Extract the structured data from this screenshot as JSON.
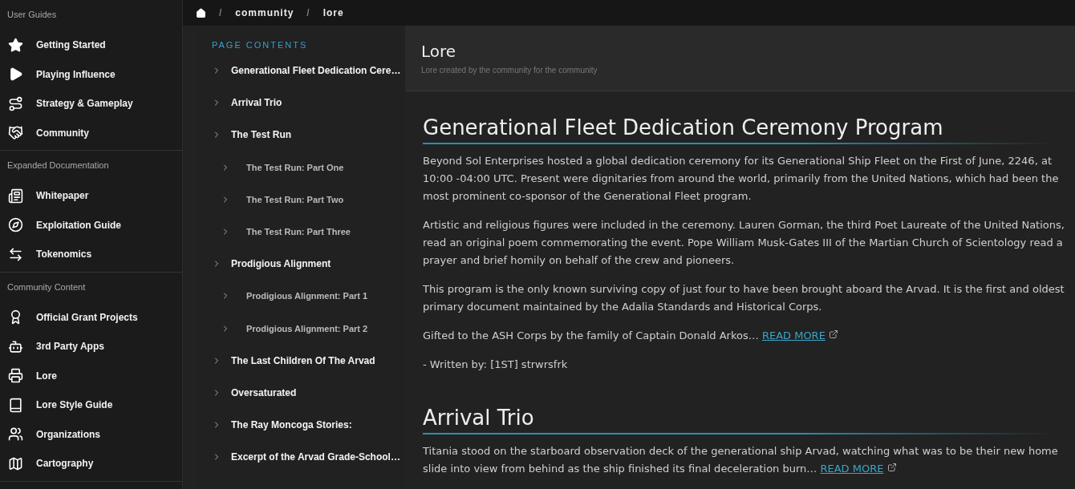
{
  "sidebar": {
    "sections": [
      {
        "title": "User Guides",
        "items": [
          {
            "label": "Getting Started"
          },
          {
            "label": "Playing Influence"
          },
          {
            "label": "Strategy & Gameplay"
          },
          {
            "label": "Community"
          }
        ]
      },
      {
        "title": "Expanded Documentation",
        "items": [
          {
            "label": "Whitepaper"
          },
          {
            "label": "Exploitation Guide"
          },
          {
            "label": "Tokenomics"
          }
        ]
      },
      {
        "title": "Community Content",
        "items": [
          {
            "label": "Official Grant Projects"
          },
          {
            "label": "3rd Party Apps"
          },
          {
            "label": "Lore"
          },
          {
            "label": "Lore Style Guide"
          },
          {
            "label": "Organizations"
          },
          {
            "label": "Cartography"
          }
        ]
      }
    ]
  },
  "breadcrumbs": [
    {
      "separator": "/",
      "label": "community"
    },
    {
      "separator": "/",
      "label": "lore"
    }
  ],
  "page_contents": {
    "title": "PAGE CONTENTS",
    "items": [
      {
        "label": "Generational Fleet Dedication Cere…"
      },
      {
        "label": "Arrival Trio"
      },
      {
        "label": "The Test Run",
        "children": [
          {
            "label": "The Test Run: Part One"
          },
          {
            "label": "The Test Run: Part Two"
          },
          {
            "label": "The Test Run: Part Three"
          }
        ]
      },
      {
        "label": "Prodigious Alignment",
        "children": [
          {
            "label": "Prodigious Alignment: Part 1"
          },
          {
            "label": "Prodigious Alignment: Part 2"
          }
        ]
      },
      {
        "label": "The Last Children Of The Arvad"
      },
      {
        "label": "Oversaturated"
      },
      {
        "label": "The Ray Moncoga Stories:"
      },
      {
        "label": "Excerpt of the Arvad Grade-School…"
      }
    ]
  },
  "header": {
    "title": "Lore",
    "subtitle": "Lore created by the community for the community"
  },
  "articles": [
    {
      "title": "Generational Fleet Dedication Ceremony Program",
      "paragraphs": [
        {
          "text": "Beyond Sol Enterprises hosted a global dedication ceremony for its Generational Ship Fleet on the First of June, 2246, at 10:00 -04:00 UTC. Present were dignitaries from around the world, primarily from the United Nations, which had been the most prominent co-sponsor of the Generational Fleet program."
        },
        {
          "text": "Artistic and religious figures were included in the ceremony. Lauren Gorman, the third Poet Laureate of the United Nations, read an original poem commemorating the event. Pope William Musk-Gates III of the Martian Church of Scientology read a prayer and brief homily on behalf of the crew and pioneers."
        },
        {
          "text": "This program is the only known surviving copy of just four to have been brought aboard the Arvad. It is the first and oldest primary document maintained by the Adalia Standards and Historical Corps."
        },
        {
          "text": "Gifted to the ASH Corps by the family of Captain Donald Arkos…",
          "link": "READ MORE"
        },
        {
          "text": "- Written by: [1ST] strwrsfrk"
        }
      ]
    },
    {
      "title": "Arrival Trio",
      "paragraphs": [
        {
          "text": "Titania stood on the starboard observation deck of the generational ship Arvad, watching what was to be their new home slide into view from behind as the ship finished its final deceleration burn…",
          "link": "READ MORE"
        }
      ]
    }
  ]
}
